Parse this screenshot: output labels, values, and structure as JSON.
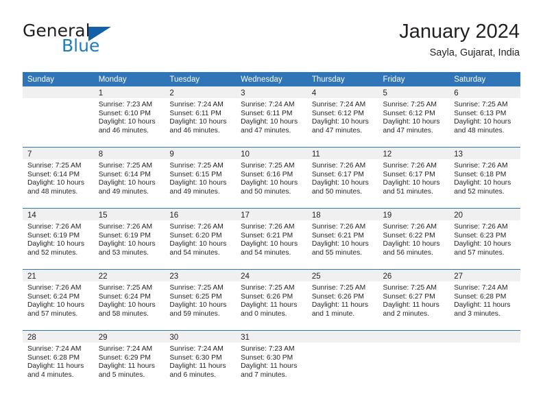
{
  "brand": {
    "name_part1": "General",
    "name_part2": "Blue",
    "logo_icon": "blue-triangle-logo"
  },
  "header": {
    "title": "January 2024",
    "subtitle": "Sayla, Gujarat, India"
  },
  "colors": {
    "header_blue": "#3075b8",
    "brand_blue": "#1b7cc1",
    "logo_blue": "#1460a8",
    "daynum_band": "#f0f0f0",
    "text": "#231f20"
  },
  "weekday_headers": [
    "Sunday",
    "Monday",
    "Tuesday",
    "Wednesday",
    "Thursday",
    "Friday",
    "Saturday"
  ],
  "weeks": [
    [
      {
        "day": "",
        "sunrise": "",
        "sunset": "",
        "daylight_line1": "",
        "daylight_line2": ""
      },
      {
        "day": "1",
        "sunrise": "Sunrise: 7:23 AM",
        "sunset": "Sunset: 6:10 PM",
        "daylight_line1": "Daylight: 10 hours",
        "daylight_line2": "and 46 minutes."
      },
      {
        "day": "2",
        "sunrise": "Sunrise: 7:24 AM",
        "sunset": "Sunset: 6:11 PM",
        "daylight_line1": "Daylight: 10 hours",
        "daylight_line2": "and 46 minutes."
      },
      {
        "day": "3",
        "sunrise": "Sunrise: 7:24 AM",
        "sunset": "Sunset: 6:11 PM",
        "daylight_line1": "Daylight: 10 hours",
        "daylight_line2": "and 47 minutes."
      },
      {
        "day": "4",
        "sunrise": "Sunrise: 7:24 AM",
        "sunset": "Sunset: 6:12 PM",
        "daylight_line1": "Daylight: 10 hours",
        "daylight_line2": "and 47 minutes."
      },
      {
        "day": "5",
        "sunrise": "Sunrise: 7:25 AM",
        "sunset": "Sunset: 6:12 PM",
        "daylight_line1": "Daylight: 10 hours",
        "daylight_line2": "and 47 minutes."
      },
      {
        "day": "6",
        "sunrise": "Sunrise: 7:25 AM",
        "sunset": "Sunset: 6:13 PM",
        "daylight_line1": "Daylight: 10 hours",
        "daylight_line2": "and 48 minutes."
      }
    ],
    [
      {
        "day": "7",
        "sunrise": "Sunrise: 7:25 AM",
        "sunset": "Sunset: 6:14 PM",
        "daylight_line1": "Daylight: 10 hours",
        "daylight_line2": "and 48 minutes."
      },
      {
        "day": "8",
        "sunrise": "Sunrise: 7:25 AM",
        "sunset": "Sunset: 6:14 PM",
        "daylight_line1": "Daylight: 10 hours",
        "daylight_line2": "and 49 minutes."
      },
      {
        "day": "9",
        "sunrise": "Sunrise: 7:25 AM",
        "sunset": "Sunset: 6:15 PM",
        "daylight_line1": "Daylight: 10 hours",
        "daylight_line2": "and 49 minutes."
      },
      {
        "day": "10",
        "sunrise": "Sunrise: 7:25 AM",
        "sunset": "Sunset: 6:16 PM",
        "daylight_line1": "Daylight: 10 hours",
        "daylight_line2": "and 50 minutes."
      },
      {
        "day": "11",
        "sunrise": "Sunrise: 7:26 AM",
        "sunset": "Sunset: 6:17 PM",
        "daylight_line1": "Daylight: 10 hours",
        "daylight_line2": "and 50 minutes."
      },
      {
        "day": "12",
        "sunrise": "Sunrise: 7:26 AM",
        "sunset": "Sunset: 6:17 PM",
        "daylight_line1": "Daylight: 10 hours",
        "daylight_line2": "and 51 minutes."
      },
      {
        "day": "13",
        "sunrise": "Sunrise: 7:26 AM",
        "sunset": "Sunset: 6:18 PM",
        "daylight_line1": "Daylight: 10 hours",
        "daylight_line2": "and 52 minutes."
      }
    ],
    [
      {
        "day": "14",
        "sunrise": "Sunrise: 7:26 AM",
        "sunset": "Sunset: 6:19 PM",
        "daylight_line1": "Daylight: 10 hours",
        "daylight_line2": "and 52 minutes."
      },
      {
        "day": "15",
        "sunrise": "Sunrise: 7:26 AM",
        "sunset": "Sunset: 6:19 PM",
        "daylight_line1": "Daylight: 10 hours",
        "daylight_line2": "and 53 minutes."
      },
      {
        "day": "16",
        "sunrise": "Sunrise: 7:26 AM",
        "sunset": "Sunset: 6:20 PM",
        "daylight_line1": "Daylight: 10 hours",
        "daylight_line2": "and 54 minutes."
      },
      {
        "day": "17",
        "sunrise": "Sunrise: 7:26 AM",
        "sunset": "Sunset: 6:21 PM",
        "daylight_line1": "Daylight: 10 hours",
        "daylight_line2": "and 54 minutes."
      },
      {
        "day": "18",
        "sunrise": "Sunrise: 7:26 AM",
        "sunset": "Sunset: 6:21 PM",
        "daylight_line1": "Daylight: 10 hours",
        "daylight_line2": "and 55 minutes."
      },
      {
        "day": "19",
        "sunrise": "Sunrise: 7:26 AM",
        "sunset": "Sunset: 6:22 PM",
        "daylight_line1": "Daylight: 10 hours",
        "daylight_line2": "and 56 minutes."
      },
      {
        "day": "20",
        "sunrise": "Sunrise: 7:26 AM",
        "sunset": "Sunset: 6:23 PM",
        "daylight_line1": "Daylight: 10 hours",
        "daylight_line2": "and 57 minutes."
      }
    ],
    [
      {
        "day": "21",
        "sunrise": "Sunrise: 7:26 AM",
        "sunset": "Sunset: 6:24 PM",
        "daylight_line1": "Daylight: 10 hours",
        "daylight_line2": "and 57 minutes."
      },
      {
        "day": "22",
        "sunrise": "Sunrise: 7:25 AM",
        "sunset": "Sunset: 6:24 PM",
        "daylight_line1": "Daylight: 10 hours",
        "daylight_line2": "and 58 minutes."
      },
      {
        "day": "23",
        "sunrise": "Sunrise: 7:25 AM",
        "sunset": "Sunset: 6:25 PM",
        "daylight_line1": "Daylight: 10 hours",
        "daylight_line2": "and 59 minutes."
      },
      {
        "day": "24",
        "sunrise": "Sunrise: 7:25 AM",
        "sunset": "Sunset: 6:26 PM",
        "daylight_line1": "Daylight: 11 hours",
        "daylight_line2": "and 0 minutes."
      },
      {
        "day": "25",
        "sunrise": "Sunrise: 7:25 AM",
        "sunset": "Sunset: 6:26 PM",
        "daylight_line1": "Daylight: 11 hours",
        "daylight_line2": "and 1 minute."
      },
      {
        "day": "26",
        "sunrise": "Sunrise: 7:25 AM",
        "sunset": "Sunset: 6:27 PM",
        "daylight_line1": "Daylight: 11 hours",
        "daylight_line2": "and 2 minutes."
      },
      {
        "day": "27",
        "sunrise": "Sunrise: 7:24 AM",
        "sunset": "Sunset: 6:28 PM",
        "daylight_line1": "Daylight: 11 hours",
        "daylight_line2": "and 3 minutes."
      }
    ],
    [
      {
        "day": "28",
        "sunrise": "Sunrise: 7:24 AM",
        "sunset": "Sunset: 6:28 PM",
        "daylight_line1": "Daylight: 11 hours",
        "daylight_line2": "and 4 minutes."
      },
      {
        "day": "29",
        "sunrise": "Sunrise: 7:24 AM",
        "sunset": "Sunset: 6:29 PM",
        "daylight_line1": "Daylight: 11 hours",
        "daylight_line2": "and 5 minutes."
      },
      {
        "day": "30",
        "sunrise": "Sunrise: 7:24 AM",
        "sunset": "Sunset: 6:30 PM",
        "daylight_line1": "Daylight: 11 hours",
        "daylight_line2": "and 6 minutes."
      },
      {
        "day": "31",
        "sunrise": "Sunrise: 7:23 AM",
        "sunset": "Sunset: 6:30 PM",
        "daylight_line1": "Daylight: 11 hours",
        "daylight_line2": "and 7 minutes."
      },
      {
        "day": "",
        "sunrise": "",
        "sunset": "",
        "daylight_line1": "",
        "daylight_line2": ""
      },
      {
        "day": "",
        "sunrise": "",
        "sunset": "",
        "daylight_line1": "",
        "daylight_line2": ""
      },
      {
        "day": "",
        "sunrise": "",
        "sunset": "",
        "daylight_line1": "",
        "daylight_line2": ""
      }
    ]
  ]
}
